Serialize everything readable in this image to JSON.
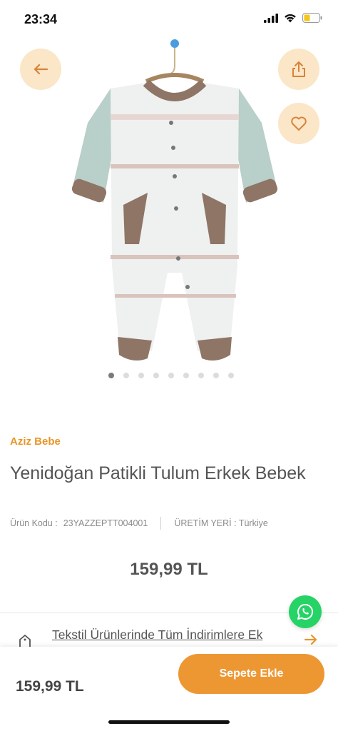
{
  "status_bar": {
    "time": "23:34",
    "battery_color": "#f5c518"
  },
  "product": {
    "brand": "Aziz Bebe",
    "title": "Yenidoğan Patikli Tulum Erkek Bebek",
    "code_label": "Ürün Kodu :",
    "code_value": "23YAZZEPTT004001",
    "origin_label": "ÜRETİM YERİ : Türkiye",
    "price": "159,99 TL",
    "image_count": 9,
    "active_image_index": 0
  },
  "promo": {
    "text": "Tekstil Ürünlerinde Tüm İndirimlere Ek"
  },
  "bottom": {
    "price": "159,99 TL",
    "cart_label": "Sepete Ekle"
  },
  "icons": {
    "back": "arrow-left-icon",
    "share": "share-icon",
    "favorite": "heart-icon",
    "whatsapp": "whatsapp-icon",
    "promo": "tag-icon",
    "promo_arrow": "arrow-right-icon"
  },
  "colors": {
    "accent": "#ed9733",
    "brand_text": "#e8962a",
    "circle_bg": "#fbe6c8",
    "whatsapp": "#25d366"
  }
}
